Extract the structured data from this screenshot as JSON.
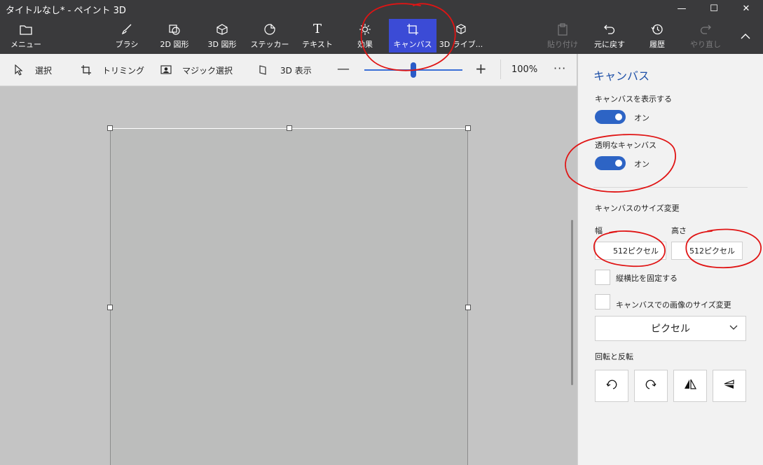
{
  "window": {
    "title": "タイトルなし* - ペイント 3D",
    "minimize_glyph": "—",
    "maximize_glyph": "☐",
    "close_glyph": "✕"
  },
  "ribbon": {
    "menu": "メニュー",
    "brush": "ブラシ",
    "shapes2d": "2D 図形",
    "shapes3d": "3D 図形",
    "stickers": "ステッカー",
    "text": "テキスト",
    "effects": "効果",
    "canvas": "キャンバス",
    "library3d": "3D ライブ...",
    "paste": "貼り付け",
    "undo": "元に戻す",
    "history": "履歴",
    "redo": "やり直し"
  },
  "toolbar": {
    "select": "選択",
    "crop": "トリミング",
    "magic_select": "マジック選択",
    "view3d": "3D 表示",
    "zoom_percent": "100%",
    "zoom_level": 0.5,
    "more": "···"
  },
  "panel": {
    "title": "キャンバス",
    "show_canvas_label": "キャンバスを表示する",
    "show_canvas_state": "オン",
    "transparent_label": "透明なキャンバス",
    "transparent_state": "オン",
    "resize_label": "キャンバスのサイズ変更",
    "width_label": "幅",
    "height_label": "高さ",
    "width_value": "512ピクセル",
    "height_value": "512ピクセル",
    "lock_aspect_label": "縦横比を固定する",
    "resize_image_label": "キャンバスでの画像のサイズ変更",
    "unit_selected": "ピクセル",
    "rotate_flip_label": "回転と反転"
  },
  "colors": {
    "accent": "#2d64c5",
    "active_tab": "#3b4bd6",
    "annotation": "#e01414"
  }
}
